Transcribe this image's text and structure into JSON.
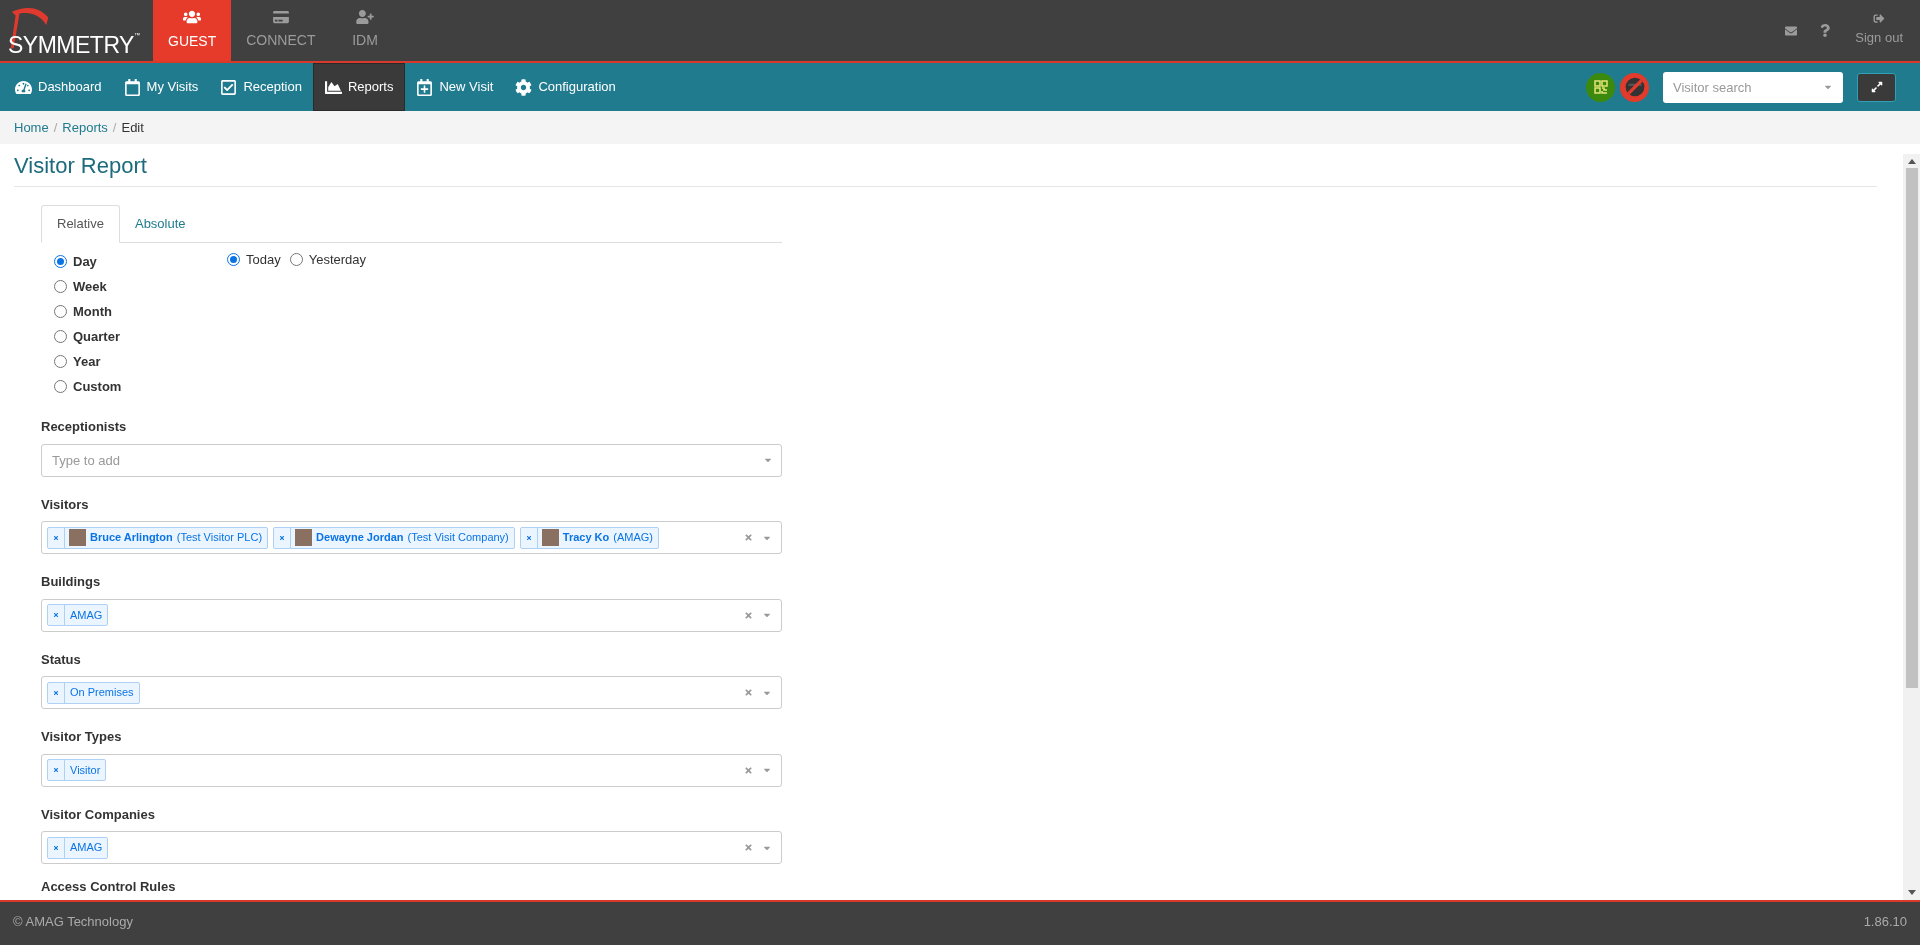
{
  "top_bar": {
    "logo": {
      "name": "SYMMETRY",
      "mark": "™"
    },
    "apps": [
      {
        "label": "GUEST",
        "kind": "guest",
        "selected": true
      },
      {
        "label": "CONNECT",
        "kind": "card",
        "selected": false
      },
      {
        "label": "IDM",
        "kind": "idm",
        "selected": false
      }
    ],
    "sign_out": "Sign out"
  },
  "nav": {
    "items": [
      {
        "label": "Dashboard",
        "kind": "dashboard",
        "selected": false
      },
      {
        "label": "My Visits",
        "kind": "calendar",
        "selected": false
      },
      {
        "label": "Reception",
        "kind": "check",
        "selected": false
      },
      {
        "label": "Reports",
        "kind": "chart",
        "selected": true
      },
      {
        "label": "New Visit",
        "kind": "calendar-plus",
        "selected": false
      },
      {
        "label": "Configuration",
        "kind": "gear",
        "selected": false
      }
    ],
    "search": {
      "placeholder": "Visitor search"
    }
  },
  "breadcrumb_separator": "/",
  "breadcrumb": [
    {
      "label": "Home",
      "selected": false
    },
    {
      "label": "Reports",
      "selected": false
    },
    {
      "label": "Edit",
      "selected": true
    }
  ],
  "title": "Visitor Report",
  "tabs": [
    {
      "label": "Relative",
      "selected": true
    },
    {
      "label": "Absolute",
      "selected": false
    }
  ],
  "periods": [
    {
      "label": "Day",
      "selected": true
    },
    {
      "label": "Week",
      "selected": false
    },
    {
      "label": "Month",
      "selected": false
    },
    {
      "label": "Quarter",
      "selected": false
    },
    {
      "label": "Year",
      "selected": false
    },
    {
      "label": "Custom",
      "selected": false
    }
  ],
  "days": [
    {
      "label": "Today",
      "selected": true
    },
    {
      "label": "Yesterday",
      "selected": false
    }
  ],
  "fields": [
    {
      "label": "Receptionists",
      "placeholder": "Type to add"
    },
    {
      "label": "Visitors",
      "tags": [
        {
          "kind": "person",
          "name": "Bruce Arlington",
          "detail": "(Test Visitor PLC)"
        },
        {
          "kind": "person",
          "name": "Dewayne Jordan",
          "detail": "(Test Visit Company)"
        },
        {
          "kind": "person",
          "name": "Tracy Ko",
          "detail": "(AMAG)"
        }
      ]
    },
    {
      "label": "Buildings",
      "tags": [
        {
          "kind": "plain",
          "name": "AMAG"
        }
      ]
    },
    {
      "label": "Status",
      "tags": [
        {
          "kind": "plain",
          "name": "On Premises"
        }
      ]
    },
    {
      "label": "Visitor Types",
      "tags": [
        {
          "kind": "plain",
          "name": "Visitor"
        }
      ]
    },
    {
      "label": "Visitor Companies",
      "tags": [
        {
          "kind": "plain",
          "name": "AMAG"
        }
      ]
    }
  ],
  "next_section": "Access Control Rules",
  "footer": {
    "copyright": "© AMAG Technology",
    "version": "1.86.10"
  }
}
